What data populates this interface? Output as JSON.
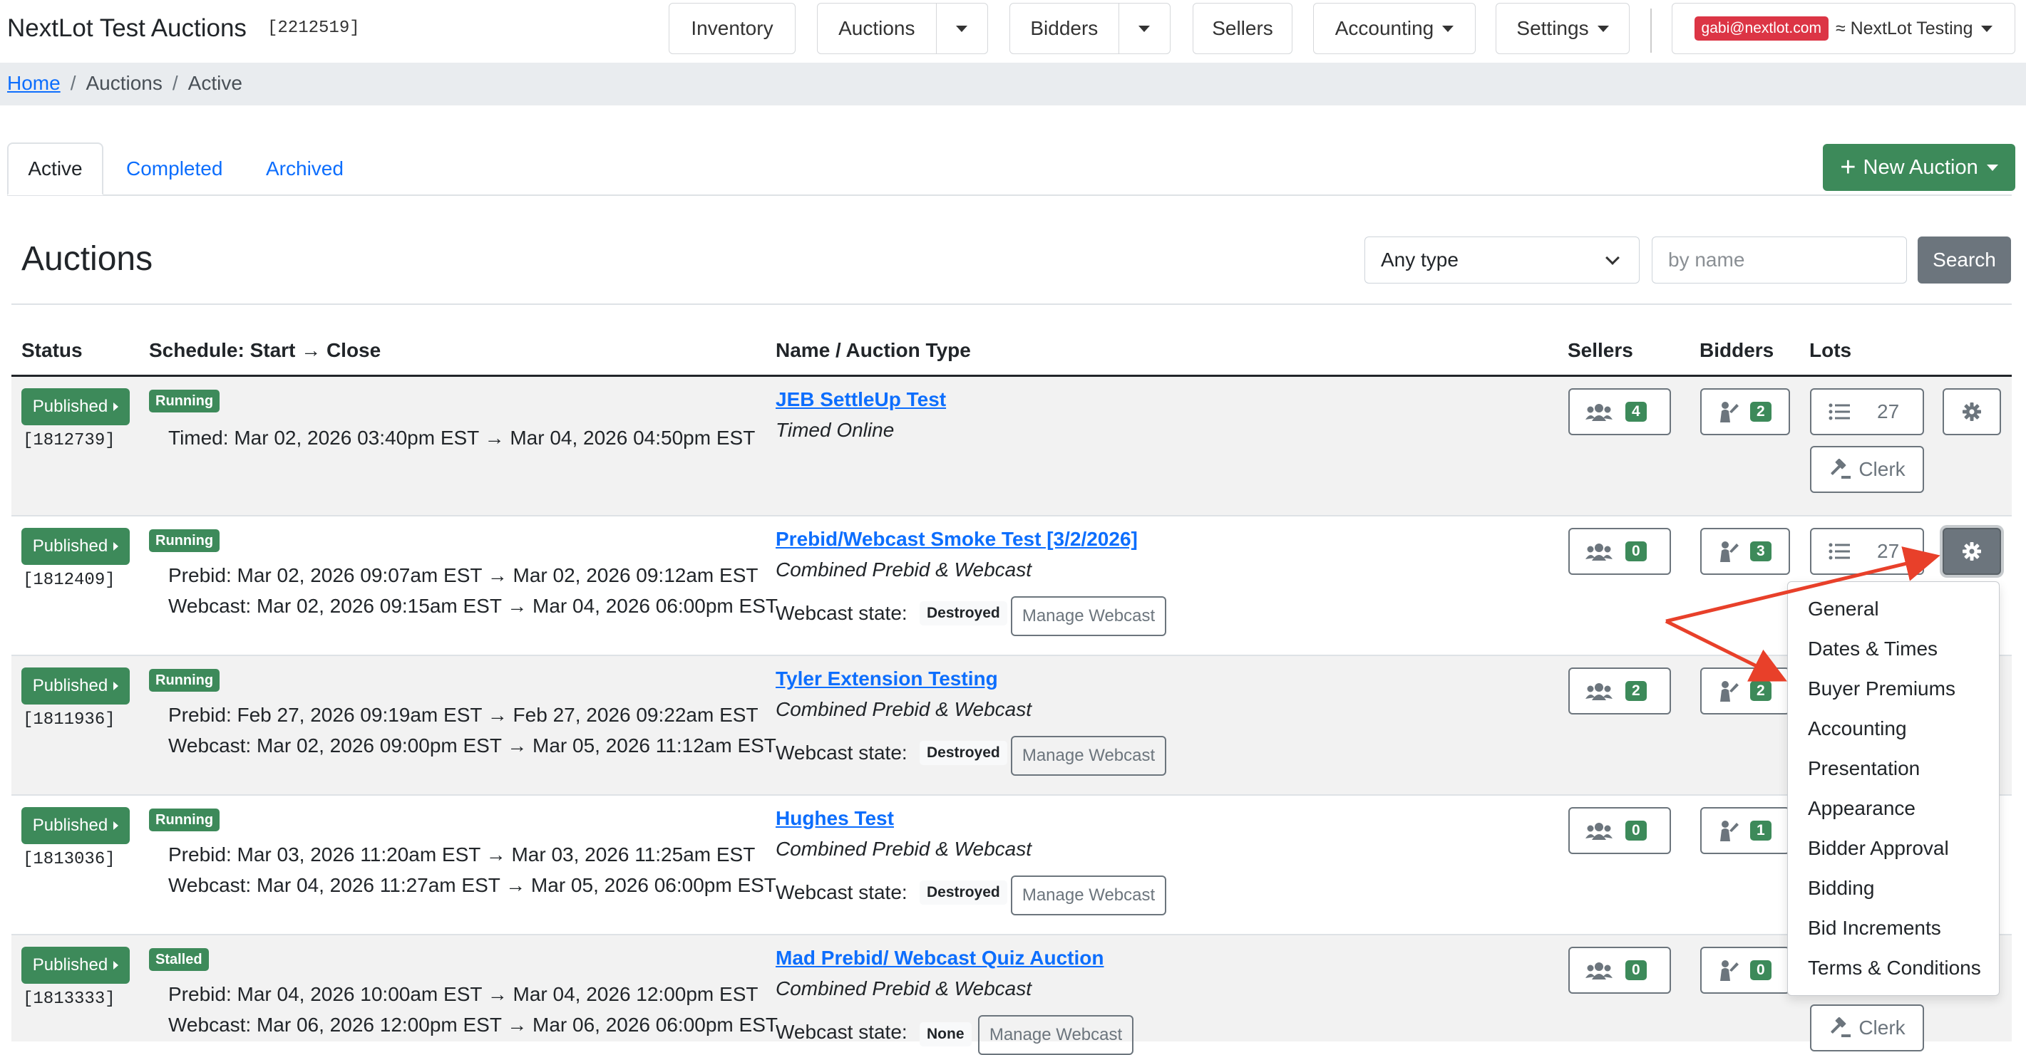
{
  "app": {
    "title": "NextLot Test Auctions",
    "id": "[2212519]"
  },
  "nav": {
    "inventory": "Inventory",
    "auctions": "Auctions",
    "bidders": "Bidders",
    "sellers": "Sellers",
    "accounting": "Accounting",
    "settings": "Settings",
    "user_email": "gabi@nextlot.com",
    "account": "≈ NextLot Testing"
  },
  "breadcrumb": [
    "Home",
    "Auctions",
    "Active"
  ],
  "tabs": [
    "Active",
    "Completed",
    "Archived"
  ],
  "new_auction": "New Auction",
  "page_title": "Auctions",
  "filter": {
    "type_value": "Any type",
    "name_placeholder": "by name",
    "search": "Search"
  },
  "columns": [
    "Status",
    "Schedule: Start → Close",
    "Name / Auction Type",
    "Sellers",
    "Bidders",
    "Lots"
  ],
  "rows": [
    {
      "status": "Published",
      "id": "[1812739]",
      "state": "Running",
      "schedule": [
        "Timed: Mar 02, 2026 03:40pm EST → Mar 04, 2026 04:50pm EST"
      ],
      "name": "JEB SettleUp Test",
      "type": "Timed Online",
      "webcast_state": "",
      "sellers": "4",
      "bidders": "2",
      "lots": "27",
      "clerk": "Clerk"
    },
    {
      "status": "Published",
      "id": "[1812409]",
      "state": "Running",
      "schedule": [
        "Prebid: Mar 02, 2026 09:07am EST → Mar 02, 2026 09:12am EST",
        "Webcast: Mar 02, 2026 09:15am EST → Mar 04, 2026 06:00pm EST"
      ],
      "name": "Prebid/Webcast Smoke Test [3/2/2026]",
      "type": "Combined Prebid & Webcast",
      "webcast_state": "Destroyed",
      "sellers": "0",
      "bidders": "3",
      "lots": "27",
      "clerk": ""
    },
    {
      "status": "Published",
      "id": "[1811936]",
      "state": "Running",
      "schedule": [
        "Prebid: Feb 27, 2026 09:19am EST → Feb 27, 2026 09:22am EST",
        "Webcast: Mar 02, 2026 09:00pm EST → Mar 05, 2026 11:12am EST"
      ],
      "name": "Tyler Extension Testing",
      "type": "Combined Prebid & Webcast",
      "webcast_state": "Destroyed",
      "sellers": "2",
      "bidders": "2",
      "lots": "",
      "clerk": ""
    },
    {
      "status": "Published",
      "id": "[1813036]",
      "state": "Running",
      "schedule": [
        "Prebid: Mar 03, 2026 11:20am EST → Mar 03, 2026 11:25am EST",
        "Webcast: Mar 04, 2026 11:27am EST → Mar 05, 2026 06:00pm EST"
      ],
      "name": "Hughes Test",
      "type": "Combined Prebid & Webcast",
      "webcast_state": "Destroyed",
      "sellers": "0",
      "bidders": "1",
      "lots": "",
      "clerk": ""
    },
    {
      "status": "Published",
      "id": "[1813333]",
      "state": "Stalled",
      "schedule": [
        "Prebid: Mar 04, 2026 10:00am EST → Mar 04, 2026 12:00pm EST",
        "Webcast: Mar 06, 2026 12:00pm EST → Mar 06, 2026 06:00pm EST"
      ],
      "name": "Mad Prebid/ Webcast Quiz Auction",
      "type": "Combined Prebid & Webcast",
      "webcast_state": "None",
      "sellers": "0",
      "bidders": "0",
      "lots": "",
      "clerk": "Clerk"
    }
  ],
  "webcast_label": "Webcast state:",
  "manage_webcast": "Manage Webcast",
  "settings_menu": [
    "General",
    "Dates & Times",
    "Buyer Premiums",
    "Accounting",
    "Presentation",
    "Appearance",
    "Bidder Approval",
    "Bidding",
    "Bid Increments",
    "Terms & Conditions"
  ],
  "colors": {
    "green": "#3d8a5a",
    "gray": "#6c757d",
    "link": "#0d6efd",
    "red_badge": "#dc3545",
    "annotation": "#e8402a"
  },
  "icons": [
    "chevron-down-icon",
    "plus-icon",
    "users-icon",
    "bidder-icon",
    "list-icon",
    "gear-icon",
    "gavel-icon",
    "caret-right-icon"
  ]
}
